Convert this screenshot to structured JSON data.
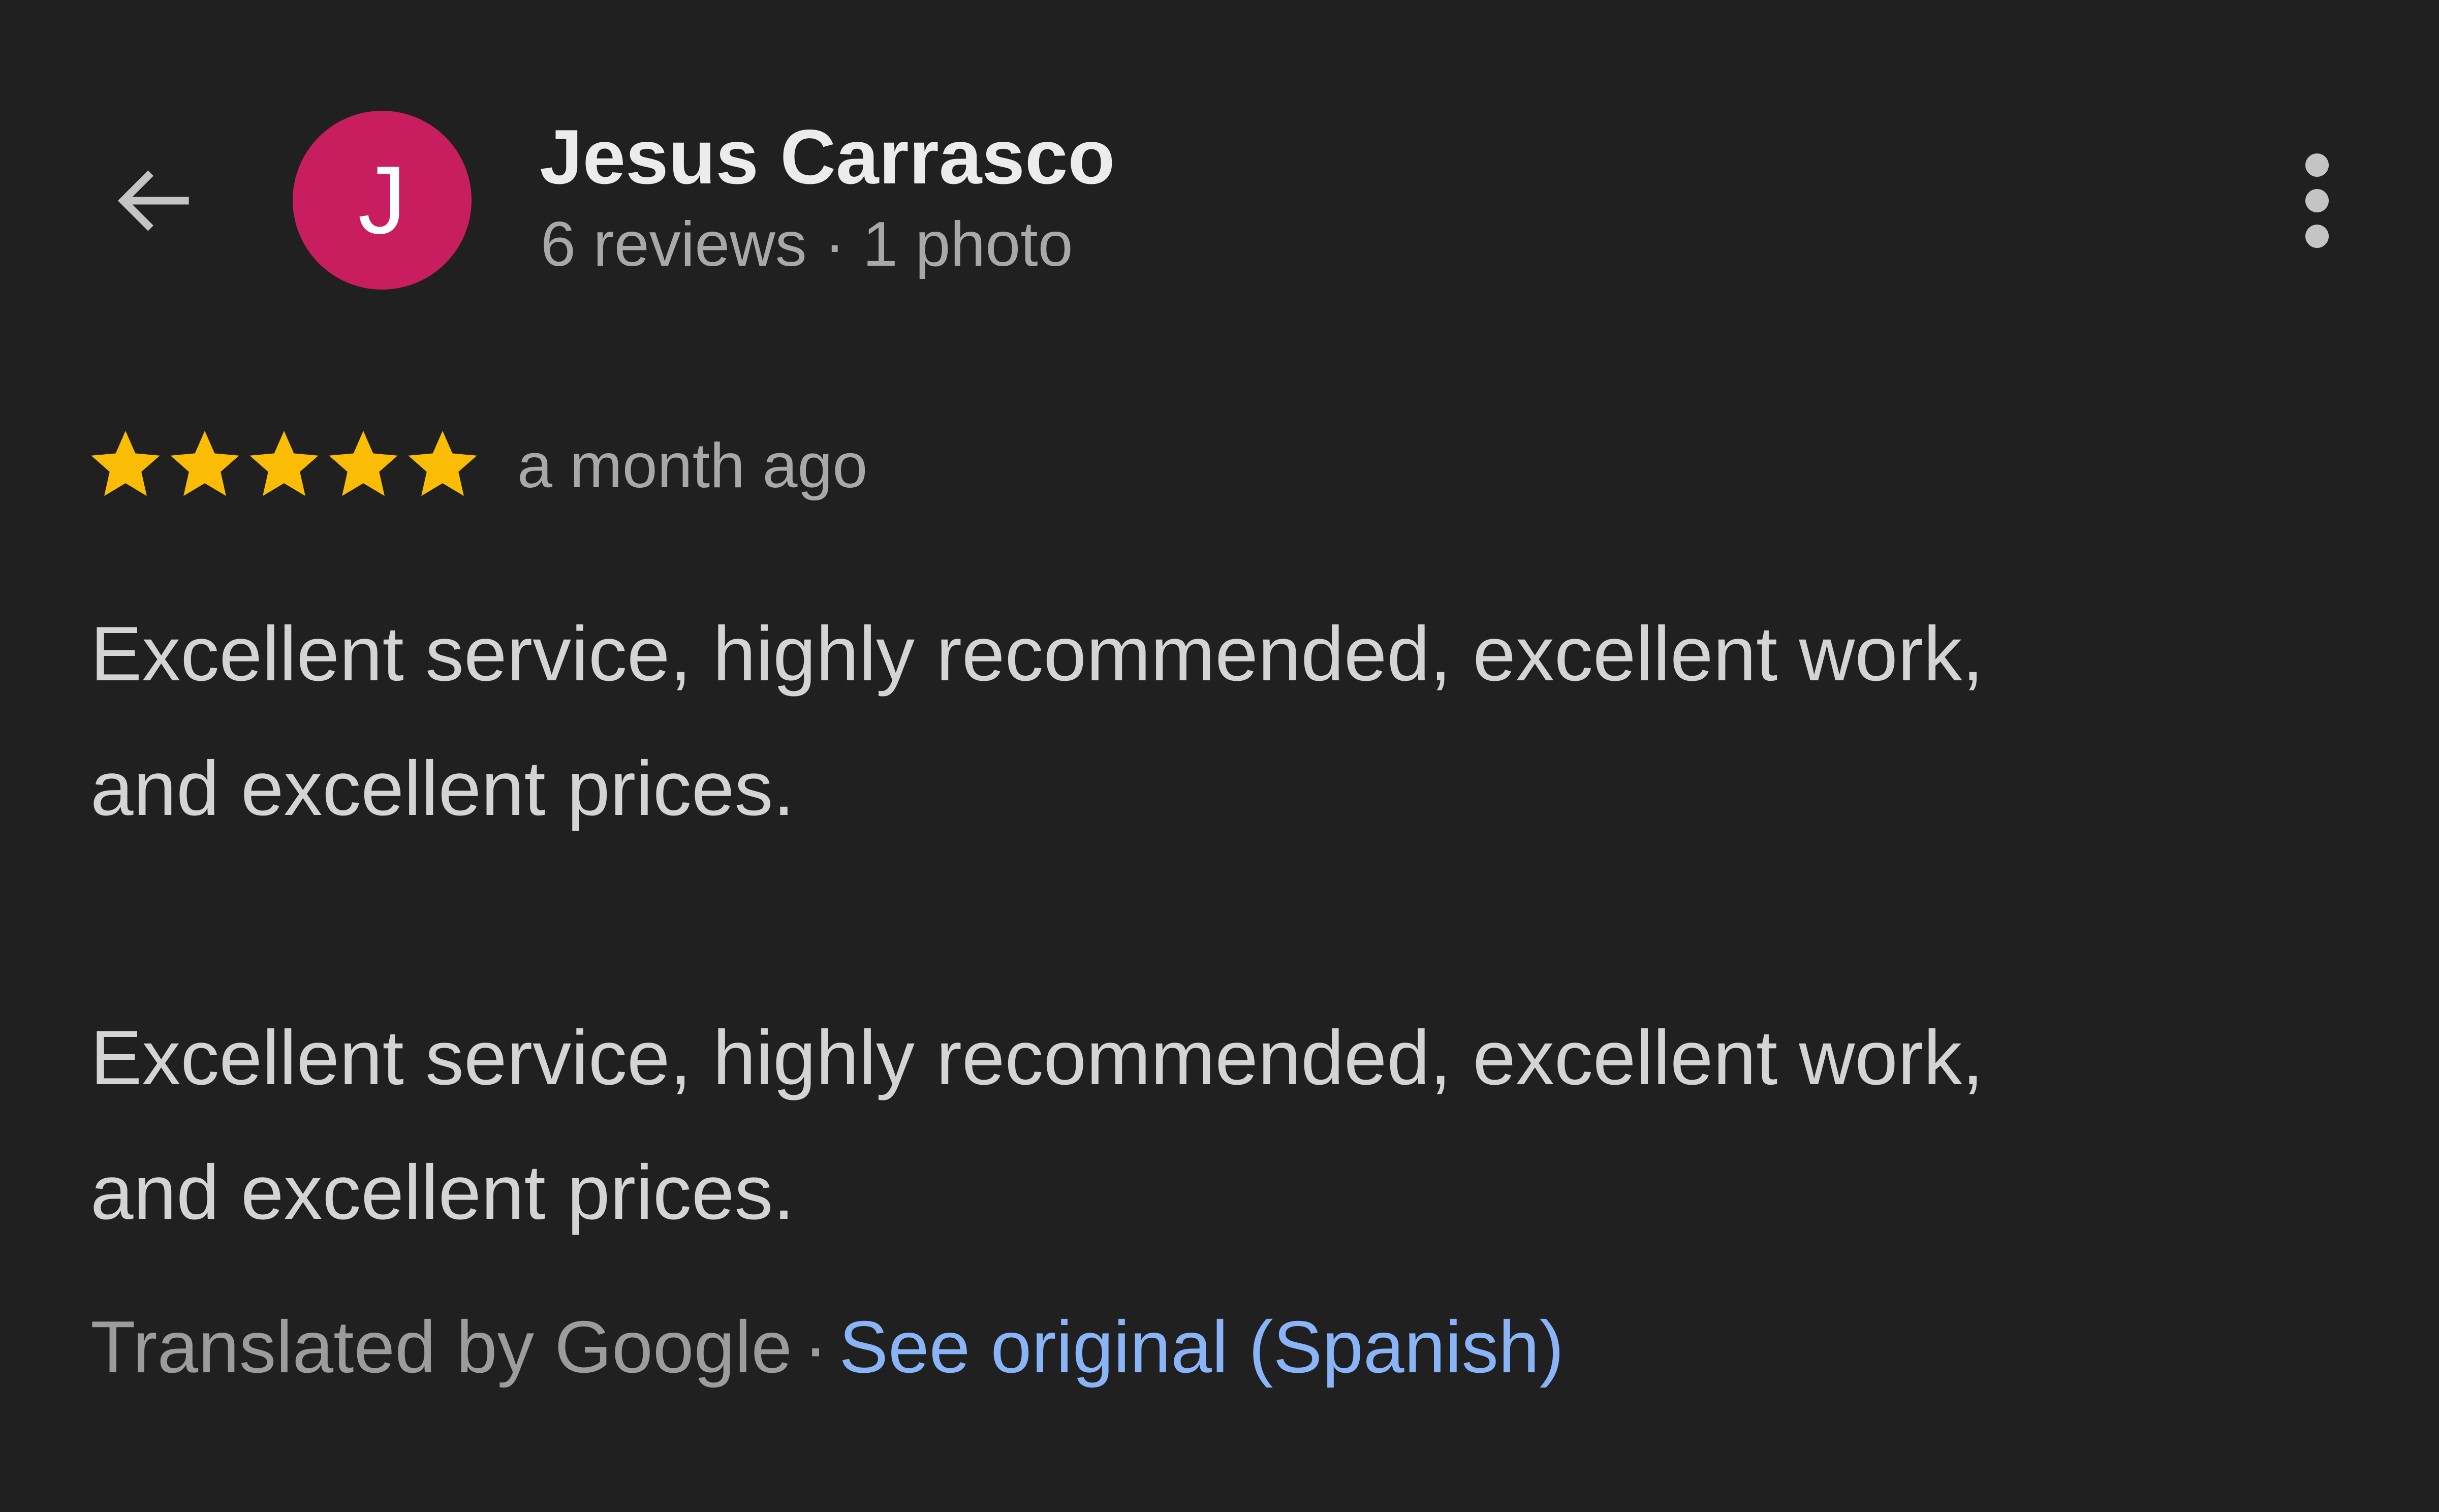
{
  "colors": {
    "background": "#202020",
    "avatar_bg": "#c81d5e",
    "star": "#fbbc04",
    "link": "#8ab4f8",
    "icon": "#c4c4c4"
  },
  "header": {
    "back_icon": "arrow-left-icon",
    "avatar_initial": "J",
    "reviewer_name": "Jesus Carrasco",
    "reviewer_stats": "6 reviews · 1 photo",
    "more_icon": "more-vertical-icon"
  },
  "review": {
    "rating": 5,
    "rating_max": 5,
    "date": "a month ago",
    "translated_text": "Excellent service, highly recommended, excellent work,\nand excellent prices.",
    "original_text": "Excellent service, highly recommended, excellent work,\nand excellent prices."
  },
  "footer": {
    "translated_by": "Translated by Google",
    "separator": "·",
    "see_original_link": "See original (Spanish)"
  }
}
